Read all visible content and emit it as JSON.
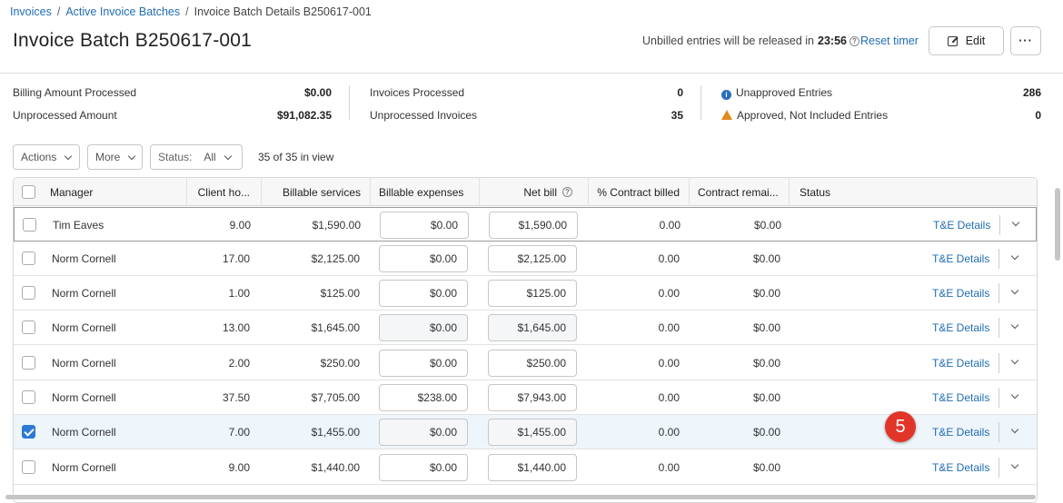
{
  "breadcrumb": [
    "Invoices",
    "Active Invoice Batches",
    "Invoice Batch Details B250617-001"
  ],
  "page_title": "Invoice Batch B250617-001",
  "timer": {
    "prefix": "Unbilled entries will be released in",
    "time": "23:56",
    "reset_label": "Reset timer"
  },
  "toolbar": {
    "edit_label": "Edit",
    "more_label": "···"
  },
  "stats": {
    "billing_amount_processed": {
      "label": "Billing Amount Processed",
      "value": "$0.00"
    },
    "unprocessed_amount": {
      "label": "Unprocessed Amount",
      "value": "$91,082.35"
    },
    "invoices_processed": {
      "label": "Invoices Processed",
      "value": "0"
    },
    "unprocessed_invoices": {
      "label": "Unprocessed Invoices",
      "value": "35"
    },
    "unapproved_entries": {
      "label": "Unapproved Entries",
      "value": "286"
    },
    "approved_not_included": {
      "label": "Approved, Not Included Entries",
      "value": "0"
    }
  },
  "filters": {
    "actions": "Actions",
    "more": "More",
    "status_label": "Status:",
    "status_value": "All",
    "in_view": "35 of 35 in view"
  },
  "columns": [
    "Manager",
    "Client ho...",
    "Billable services",
    "Billable expenses",
    "Net bill",
    "% Contract billed",
    "Contract remai...",
    "Status"
  ],
  "rows": [
    {
      "manager": "Tim Eaves",
      "hours": "9.00",
      "services": "$1,590.00",
      "expenses": "$0.00",
      "net": "$1,590.00",
      "pct": "0.00",
      "remain": "$0.00",
      "link": "T&E Details",
      "checked": false
    },
    {
      "manager": "Norm Cornell",
      "hours": "17.00",
      "services": "$2,125.00",
      "expenses": "$0.00",
      "net": "$2,125.00",
      "pct": "0.00",
      "remain": "$0.00",
      "link": "T&E Details",
      "checked": false
    },
    {
      "manager": "Norm Cornell",
      "hours": "1.00",
      "services": "$125.00",
      "expenses": "$0.00",
      "net": "$125.00",
      "pct": "0.00",
      "remain": "$0.00",
      "link": "T&E Details",
      "checked": false
    },
    {
      "manager": "Norm Cornell",
      "hours": "13.00",
      "services": "$1,645.00",
      "expenses": "$0.00",
      "net": "$1,645.00",
      "pct": "0.00",
      "remain": "$0.00",
      "link": "T&E Details",
      "checked": false
    },
    {
      "manager": "Norm Cornell",
      "hours": "2.00",
      "services": "$250.00",
      "expenses": "$0.00",
      "net": "$250.00",
      "pct": "0.00",
      "remain": "$0.00",
      "link": "T&E Details",
      "checked": false
    },
    {
      "manager": "Norm Cornell",
      "hours": "37.50",
      "services": "$7,705.00",
      "expenses": "$238.00",
      "net": "$7,943.00",
      "pct": "0.00",
      "remain": "$0.00",
      "link": "T&E Details",
      "checked": false
    },
    {
      "manager": "Norm Cornell",
      "hours": "7.00",
      "services": "$1,455.00",
      "expenses": "$0.00",
      "net": "$1,455.00",
      "pct": "0.00",
      "remain": "$0.00",
      "link": "T&E Details",
      "checked": true
    },
    {
      "manager": "Norm Cornell",
      "hours": "9.00",
      "services": "$1,440.00",
      "expenses": "$0.00",
      "net": "$1,440.00",
      "pct": "0.00",
      "remain": "$0.00",
      "link": "T&E Details",
      "checked": false
    }
  ],
  "step_badge": "5",
  "colors": {
    "link": "#1f6db3",
    "checkbox": "#2b7bd4",
    "badge": "#e2352a",
    "warning": "#e08a1e",
    "info": "#2b6fbd"
  }
}
